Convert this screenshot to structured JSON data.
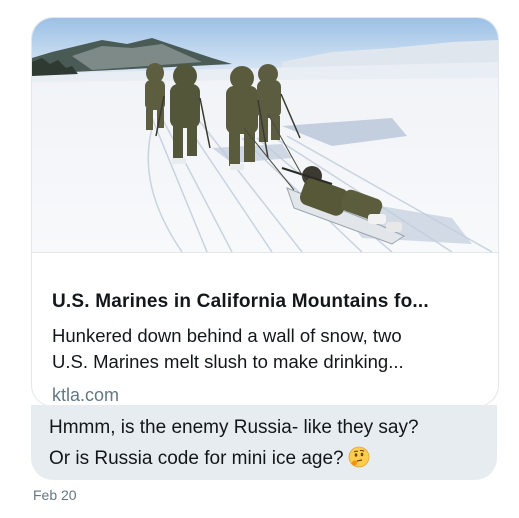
{
  "link_card": {
    "image_icon": "snow-marines-photo",
    "title": "U.S. Marines in California Mountains fo...",
    "description_line1": "Hunkered down behind a wall of snow, two",
    "description_line2": "U.S. Marines melt slush to make drinking...",
    "domain": "ktla.com"
  },
  "message": {
    "line1": "Hmmm, is the enemy Russia- like they say?",
    "line2": "Or is Russia code for mini ice age?",
    "emoji": "thinking-face"
  },
  "timestamp": "Feb 20",
  "colors": {
    "bubble_bg": "#e6ecf0",
    "card_border": "#e3e7ea",
    "text": "#14171a",
    "muted": "#657786"
  }
}
